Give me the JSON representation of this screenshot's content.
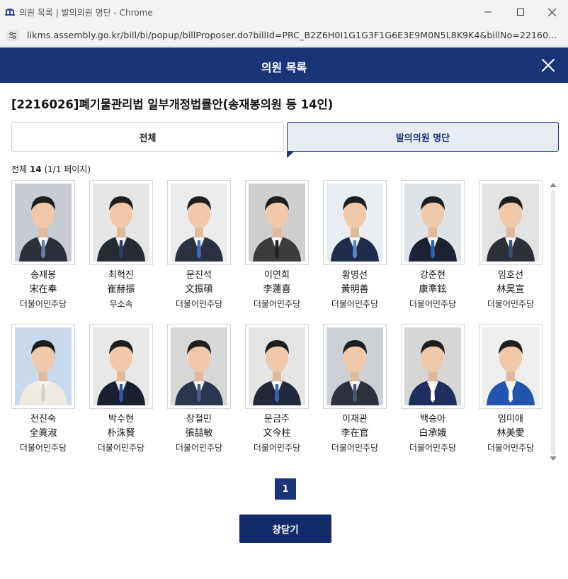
{
  "window": {
    "title": "의원 목록 | 발의의원 명단 - Chrome",
    "url": "likms.assembly.go.kr/bill/bi/popup/billProposer.do?billId=PRC_B2Z6H0I1G1G3F1G6E3E9M0N5L8K9K4&billNo=22160…"
  },
  "modal": {
    "title": "의원 목록",
    "bill_title": "[2216026]폐기물관리법 일부개정법률안(송재봉의원 등 14인)"
  },
  "tabs": {
    "all": "전체",
    "proposers": "발의의원 명단"
  },
  "count": {
    "label": "전체",
    "total": "14",
    "pages": "(1/1 페이지)"
  },
  "members": [
    {
      "name": "송재봉",
      "hanja": "宋在奉",
      "party": "더불어민주당",
      "bg": "#c8ccd2",
      "suit": "#2a2f3a",
      "tie": "#6b7fa3"
    },
    {
      "name": "최혁진",
      "hanja": "崔赫振",
      "party": "무소속",
      "bg": "#e6e6e6",
      "suit": "#262a31",
      "tie": "#2d3a6e"
    },
    {
      "name": "문진석",
      "hanja": "文振碩",
      "party": "더불어민주당",
      "bg": "#ececec",
      "suit": "#2b3140",
      "tie": "#3e6bb3"
    },
    {
      "name": "이연희",
      "hanja": "李蓮喜",
      "party": "더불어민주당",
      "bg": "#cfcfcf",
      "suit": "#3c3c3c",
      "tie": "#222222"
    },
    {
      "name": "황명선",
      "hanja": "黃明善",
      "party": "더불어민주당",
      "bg": "#e9edf1",
      "suit": "#1f2c4a",
      "tie": "#5a86c8"
    },
    {
      "name": "강준현",
      "hanja": "康準鉉",
      "party": "더불어민주당",
      "bg": "#dfe3e8",
      "suit": "#1c2233",
      "tie": "#2f5fa8"
    },
    {
      "name": "임호선",
      "hanja": "林昊宣",
      "party": "더불어민주당",
      "bg": "#e3e3e3",
      "suit": "#2e3038",
      "tie": "#3d4e7c"
    },
    {
      "name": "전진숙",
      "hanja": "全眞淑",
      "party": "더불어민주당",
      "bg": "#c9d9ec",
      "suit": "#eeeae4",
      "tie": "#d8d2c8"
    },
    {
      "name": "박수현",
      "hanja": "朴洙賢",
      "party": "더불어민주당",
      "bg": "#e8e8e8",
      "suit": "#1b2030",
      "tie": "#2c56a6"
    },
    {
      "name": "장철민",
      "hanja": "張喆敏",
      "party": "더불어민주당",
      "bg": "#d7d7d7",
      "suit": "#2a3550",
      "tie": "#4b5d8a"
    },
    {
      "name": "문금주",
      "hanja": "文今柱",
      "party": "더불어민주당",
      "bg": "#e5e5e5",
      "suit": "#23283a",
      "tie": "#3666b8"
    },
    {
      "name": "이재관",
      "hanja": "李在官",
      "party": "더불어민주당",
      "bg": "#cdd0d4",
      "suit": "#2c313d",
      "tie": "#4a5679"
    },
    {
      "name": "백승아",
      "hanja": "白承娥",
      "party": "더불어민주당",
      "bg": "#d6d6d6",
      "suit": "#1e2f5e",
      "tie": "#ffffff"
    },
    {
      "name": "임미애",
      "hanja": "林美愛",
      "party": "더불어민주당",
      "bg": "#eeeeee",
      "suit": "#2355b0",
      "tie": "#ffffff"
    }
  ],
  "pagination": {
    "current": "1"
  },
  "footer": {
    "close_label": "창닫기"
  },
  "colors": {
    "header": "#1a3478",
    "button": "#122a6a"
  }
}
